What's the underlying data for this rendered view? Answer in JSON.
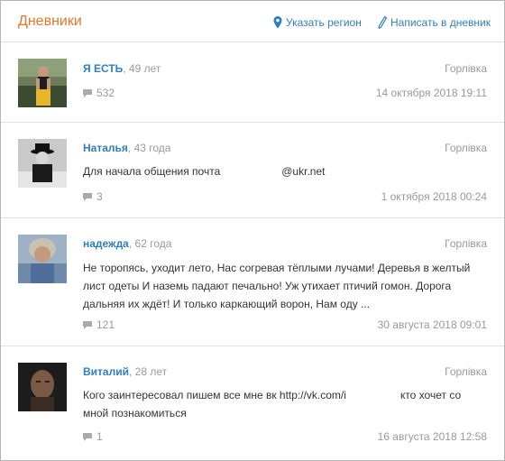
{
  "header": {
    "title": "Дневники",
    "region_link": "Указать регион",
    "write_link": "Написать в дневник"
  },
  "colors": {
    "title": "#e0792c",
    "link": "#2f7fc0",
    "muted": "#999999"
  },
  "entries": [
    {
      "author": "Я ЕСТЬ",
      "age": "49 лет",
      "city": "Горлівка",
      "text": "",
      "comments": "532",
      "date": "14 октября 2018 19:11"
    },
    {
      "author": "Наталья",
      "age": "43 года",
      "city": "Горлівка",
      "text_a": "Для начала общения почта",
      "text_b": "@ukr.net",
      "comments": "3",
      "date": "1 октября 2018 00:24"
    },
    {
      "author": "надежда",
      "age": "62 года",
      "city": "Горлівка",
      "text": "Не торопясь, уходит лето, Нас согревая тёплыми лучами! Деревья в желтый лист одеты И наземь падают печально! Уж утихает птичий гомон. Дорога дальняя их ждёт! И только каркающий ворон, Нам оду ...",
      "comments": "121",
      "date": "30 августа 2018 09:01"
    },
    {
      "author": "Виталий",
      "age": "28 лет",
      "city": "Горлівка",
      "text_a": "Кого заинтересовал пишем все мне вк http://vk.com/i",
      "text_b": "кто хочет со мной познакомиться",
      "comments": "1",
      "date": "16 августа 2018 12:58"
    }
  ]
}
